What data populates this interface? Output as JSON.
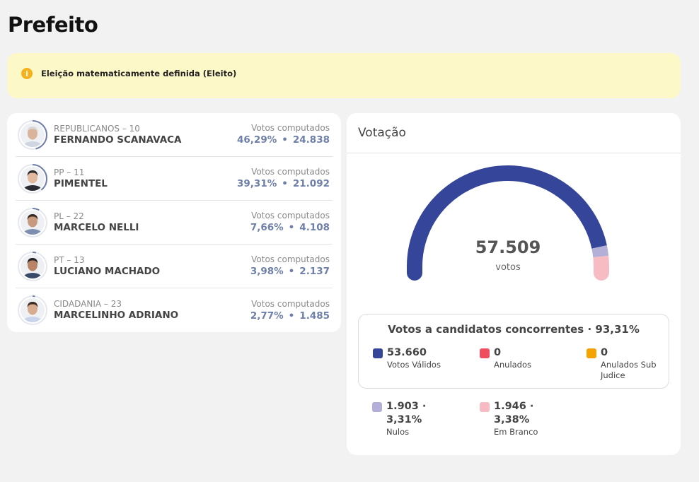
{
  "page_title": "Prefeito",
  "alert": {
    "icon": "info-icon",
    "text": "Eleição matematicamente definida (Eleito)",
    "color": "#f5b21e"
  },
  "candidates": [
    {
      "party": "REPUBLICANOS – 10",
      "name": "FERNANDO SCANAVACA",
      "votes_label": "Votos computados",
      "percent": "46,29%",
      "votes": "24.838",
      "pct_value": 46.29
    },
    {
      "party": "PP – 11",
      "name": "PIMENTEL",
      "votes_label": "Votos computados",
      "percent": "39,31%",
      "votes": "21.092",
      "pct_value": 39.31
    },
    {
      "party": "PL – 22",
      "name": "MARCELO NELLI",
      "votes_label": "Votos computados",
      "percent": "7,66%",
      "votes": "4.108",
      "pct_value": 7.66
    },
    {
      "party": "PT – 13",
      "name": "LUCIANO MACHADO",
      "votes_label": "Votos computados",
      "percent": "3,98%",
      "votes": "2.137",
      "pct_value": 3.98
    },
    {
      "party": "CIDADANIA – 23",
      "name": "MARCELINHO ADRIANO",
      "votes_label": "Votos computados",
      "percent": "2,77%",
      "votes": "1.485",
      "pct_value": 2.77
    }
  ],
  "votacao": {
    "title": "Votação",
    "total": "57.509",
    "total_caption": "votos",
    "concorrentes_title": "Votos a candidatos concorrentes · 93,31%",
    "validos": {
      "value": "53.660",
      "label": "Votos Válidos",
      "color": "#34459a",
      "amount": 53660
    },
    "anulados": {
      "value": "0",
      "label": "Anulados",
      "color": "#ee4d5f",
      "amount": 0
    },
    "anulados_sub": {
      "value": "0",
      "label": "Anulados Sub Judice",
      "color": "#f5a300",
      "amount": 0
    },
    "nulos": {
      "value": "1.903 · 3,31%",
      "label": "Nulos",
      "color": "#b4afd6",
      "amount": 1903
    },
    "branco": {
      "value": "1.946 · 3,38%",
      "label": "Em Branco",
      "color": "#f7bcc3",
      "amount": 1946
    }
  }
}
